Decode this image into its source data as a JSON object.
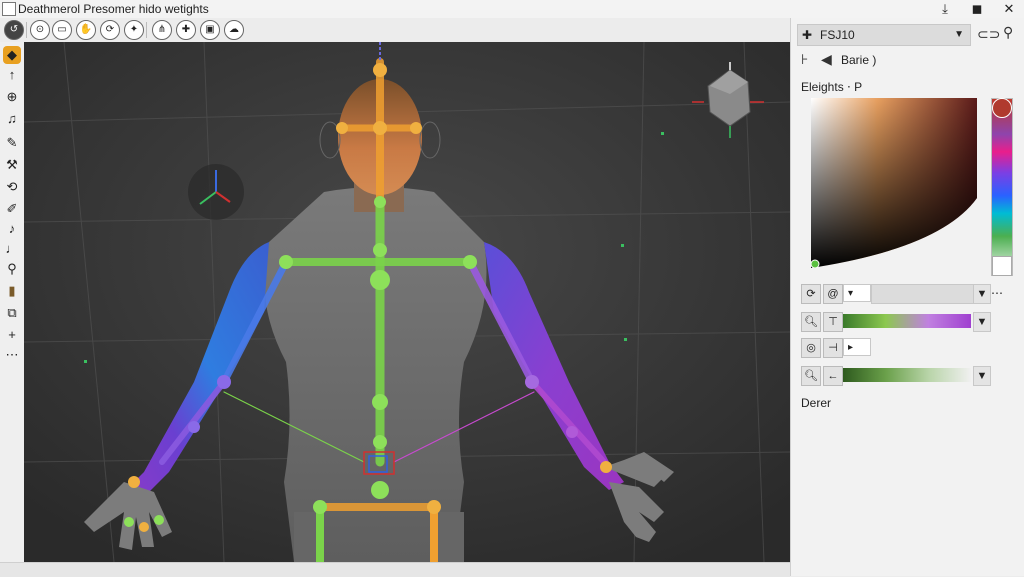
{
  "window": {
    "title": "Deathmerol Presomer hido wetights",
    "app_icon": "document-icon",
    "buttons": {
      "minimize": "minimize-icon",
      "maximize": "maximize-icon",
      "close": "close-icon"
    }
  },
  "toolbar": {
    "icons": [
      "undo-icon",
      "redo-icon",
      "folder-icon",
      "hand-icon",
      "refresh-icon",
      "pin-icon",
      "joint-icon",
      "camera-icon",
      "cloud-icon"
    ]
  },
  "leftrail": {
    "icons": [
      "move-icon",
      "arrow-up-icon",
      "globe-icon",
      "music-icon",
      "paint-icon",
      "bone-icon",
      "rotate-icon",
      "brush-icon",
      "knife-icon",
      "tag-icon",
      "pin-tool-icon",
      "flag-icon",
      "layers-icon",
      "plus-icon",
      "ellipsis-icon"
    ]
  },
  "panel": {
    "preset_dropdown": {
      "value": "FSJ10",
      "icon": "plus-icon"
    },
    "bone_row": {
      "label": "Barie )",
      "icons": [
        "pin-icon",
        "arrow-icon"
      ]
    },
    "weights_title": "Eleights ⋅ P",
    "footer_label": "Derer",
    "colors": {
      "accent_top": "#b03a2e"
    }
  },
  "viewport": {
    "gizmo_axes": [
      "x-axis",
      "y-axis",
      "z-axis"
    ]
  }
}
